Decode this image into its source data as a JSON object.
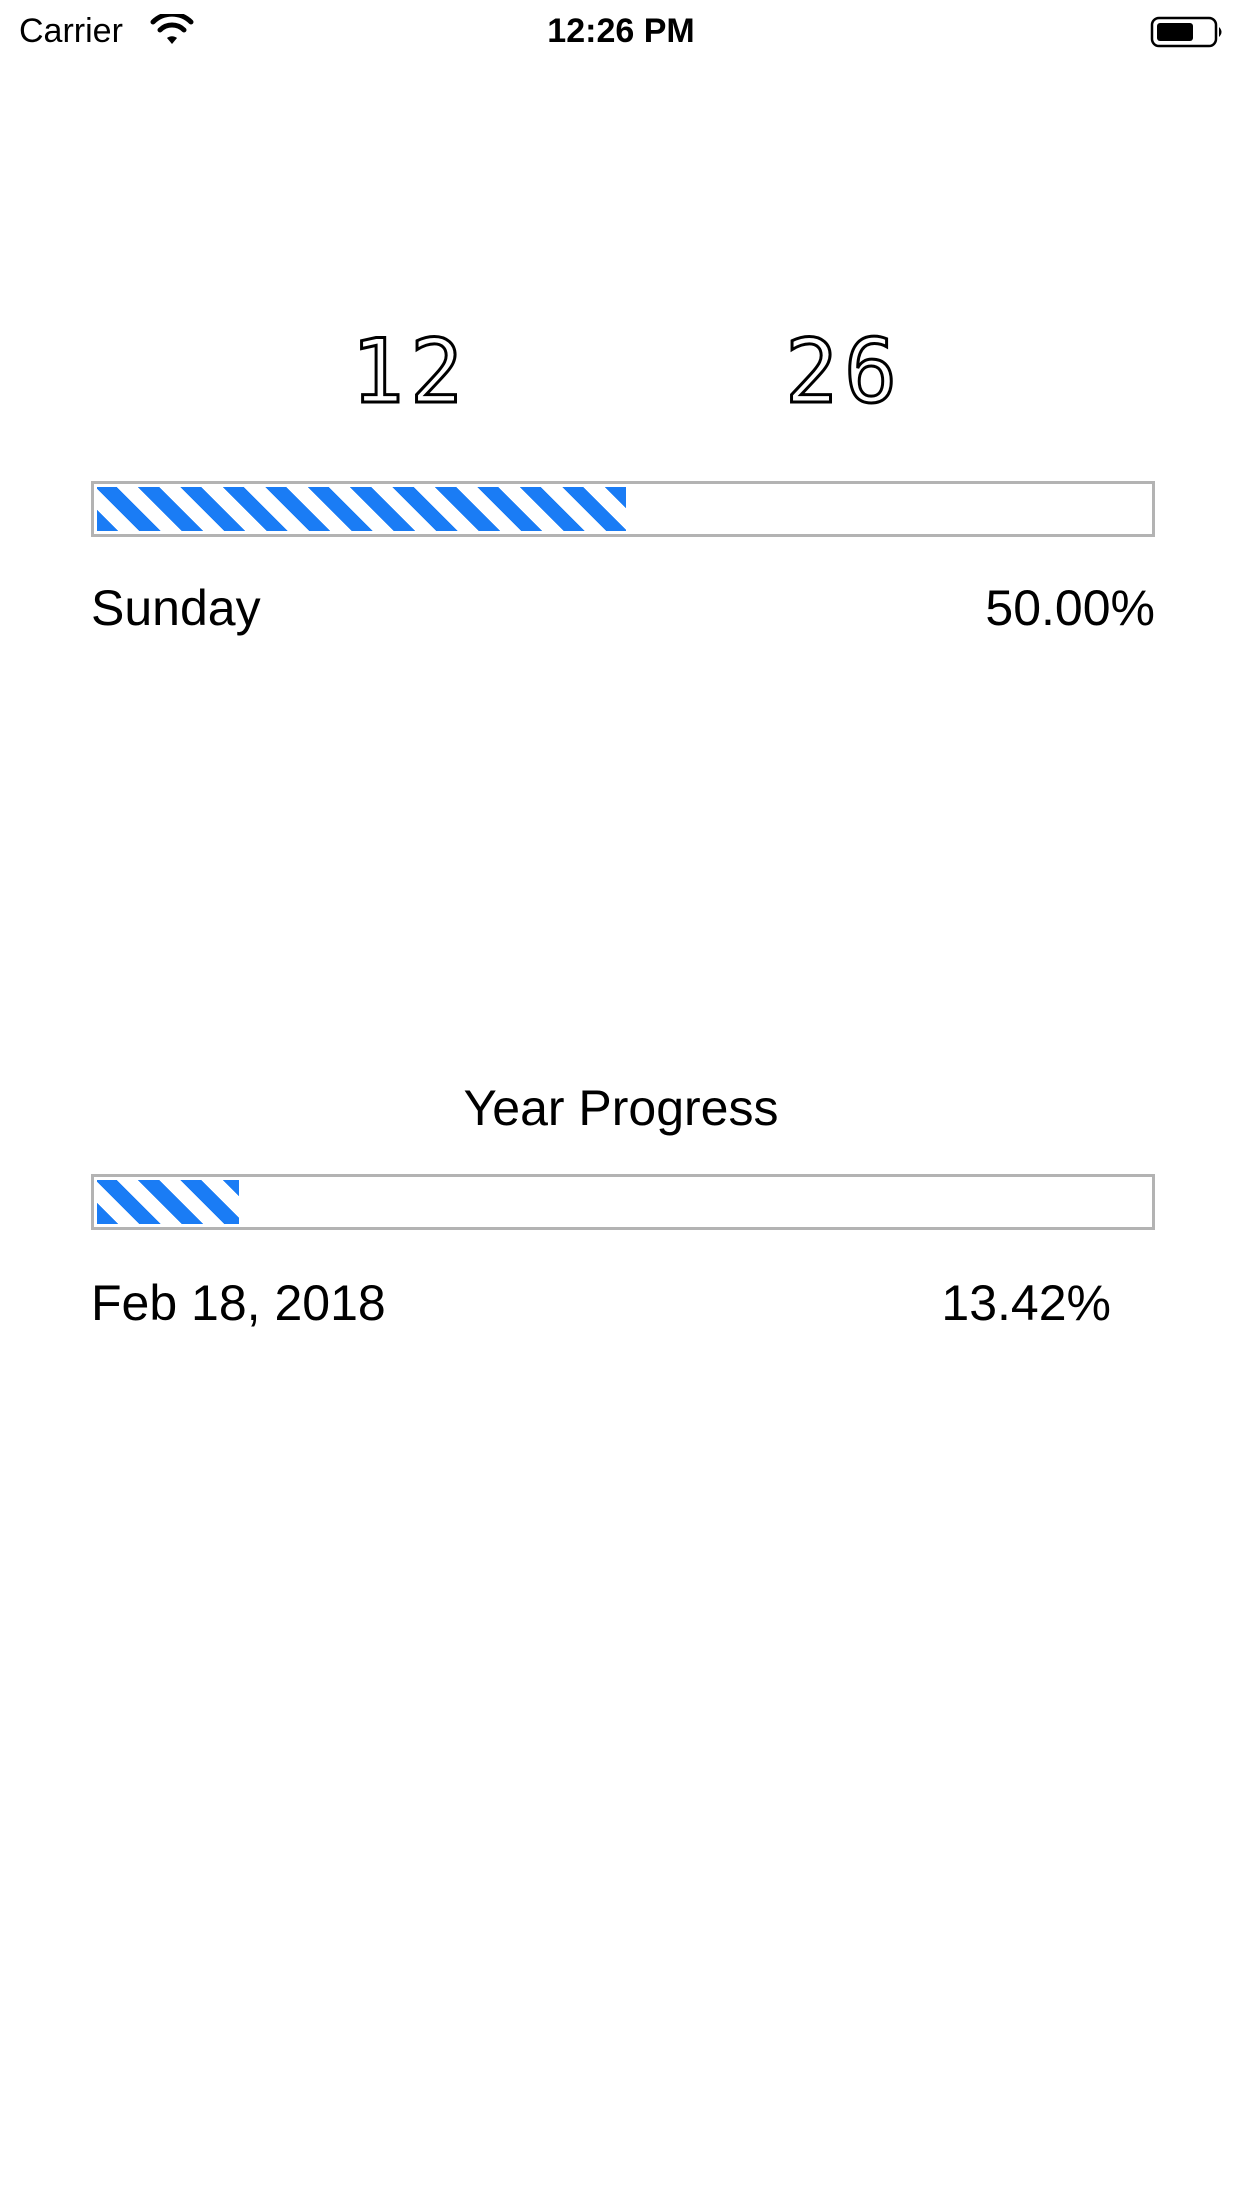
{
  "status_bar": {
    "carrier": "Carrier",
    "time": "12:26 PM",
    "wifi_icon": "wifi-icon",
    "battery_icon": "battery-icon"
  },
  "clock": {
    "hour": "12",
    "minute": "26"
  },
  "day_progress": {
    "day_name": "Sunday",
    "percent_text": "50.00%",
    "fraction": 0.5
  },
  "year_progress": {
    "title": "Year Progress",
    "date": "Feb 18, 2018",
    "percent_text": "13.42%",
    "fraction": 0.1342
  },
  "colors": {
    "accent": "#1a7cf5",
    "track_border": "#b3b3b3",
    "text": "#000000",
    "background": "#ffffff"
  }
}
